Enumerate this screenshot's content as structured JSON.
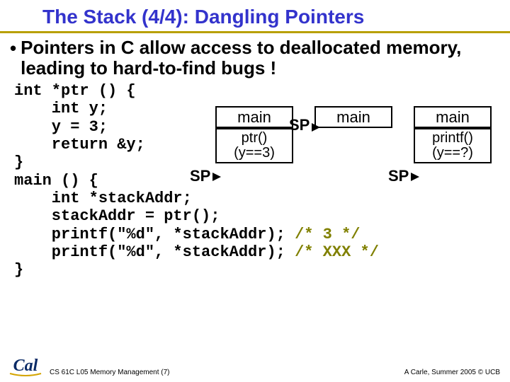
{
  "title": "The Stack (4/4): Dangling Pointers",
  "bullet": "Pointers in C allow access to deallocated memory, leading to hard-to-find bugs !",
  "code": {
    "l1": "int *ptr () {",
    "l2": "    int y;",
    "l3": "    y = 3;",
    "l4": "    return &y;",
    "l5": "}",
    "l6": "main () {",
    "l7": "    int *stackAddr;",
    "l8": "    stackAddr = ptr();",
    "l9a": "    printf(\"%d\", *stackAddr); ",
    "l9b": "/* 3 */",
    "l10a": "    printf(\"%d\", *stackAddr); ",
    "l10b": "/* XXX */",
    "l11": "}"
  },
  "stacks": {
    "sp": "SP",
    "col1": {
      "top": "main",
      "bot1": "ptr()",
      "bot2": "(y==3)"
    },
    "col2": {
      "top": "main"
    },
    "col3": {
      "top": "main",
      "bot1": "printf()",
      "bot2": "(y==?)"
    }
  },
  "footer": {
    "left": "CS 61C L05 Memory Management (7)",
    "right": "A Carle, Summer 2005 © UCB"
  }
}
